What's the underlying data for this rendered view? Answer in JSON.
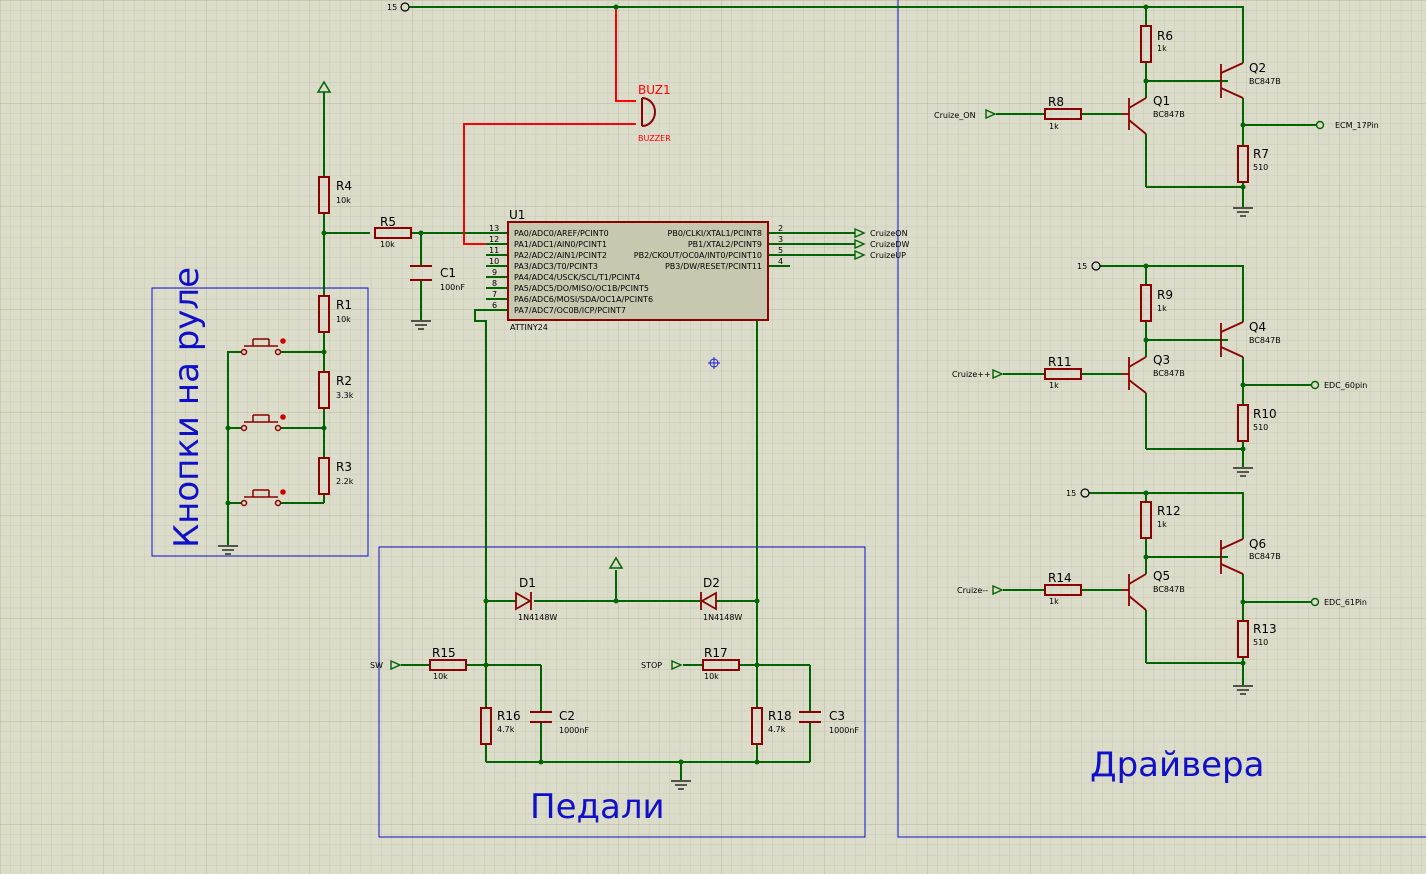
{
  "power_label": "15",
  "blocks": {
    "buttons": "Кнопки на руле",
    "pedals": "Педали",
    "drivers": "Драйвера"
  },
  "mcu": {
    "ref": "U1",
    "part": "ATTINY24",
    "left_pins": [
      {
        "num": "13",
        "name": "PA0/ADC0/AREF/PCINT0"
      },
      {
        "num": "12",
        "name": "PA1/ADC1/AIN0/PCINT1"
      },
      {
        "num": "11",
        "name": "PA2/ADC2/AIN1/PCINT2"
      },
      {
        "num": "10",
        "name": "PA3/ADC3/T0/PCINT3"
      },
      {
        "num": "9",
        "name": "PA4/ADC4/USCK/SCL/T1/PCINT4"
      },
      {
        "num": "8",
        "name": "PA5/ADC5/DO/MISO/OC1B/PCINT5"
      },
      {
        "num": "7",
        "name": "PA6/ADC6/MOSI/SDA/OC1A/PCINT6"
      },
      {
        "num": "6",
        "name": "PA7/ADC7/OC0B/ICP/PCINT7"
      }
    ],
    "right_pins": [
      {
        "num": "2",
        "name": "PB0/CLKI/XTAL1/PCINT8"
      },
      {
        "num": "3",
        "name": "PB1/XTAL2/PCINT9"
      },
      {
        "num": "5",
        "name": "PB2/CKOUT/OC0A/INT0/PCINT10"
      },
      {
        "num": "4",
        "name": "PB3/DW/RESET/PCINT11"
      }
    ]
  },
  "nets": {
    "cruize_on_out": "CruizeON",
    "cruize_dw_out": "CruizeDW",
    "cruize_up_out": "CruizeUP",
    "cruize_on_in": "Cruize_ON",
    "cruize_pp_in": "Cruize++",
    "cruize_mm_in": "Cruize--",
    "ecm": "ECM_17Pin",
    "edc60": "EDC_60pin",
    "edc61": "EDC_61Pin",
    "sw": "SW",
    "stop": "STOP"
  },
  "buzzer": {
    "ref": "BUZ1",
    "type": "BUZZER"
  },
  "resistors": {
    "R1": {
      "ref": "R1",
      "value": "10k"
    },
    "R2": {
      "ref": "R2",
      "value": "3.3k"
    },
    "R3": {
      "ref": "R3",
      "value": "2.2k"
    },
    "R4": {
      "ref": "R4",
      "value": "10k"
    },
    "R5": {
      "ref": "R5",
      "value": "10k"
    },
    "R6": {
      "ref": "R6",
      "value": "1k"
    },
    "R7": {
      "ref": "R7",
      "value": "510"
    },
    "R8": {
      "ref": "R8",
      "value": "1k"
    },
    "R9": {
      "ref": "R9",
      "value": "1k"
    },
    "R10": {
      "ref": "R10",
      "value": "510"
    },
    "R11": {
      "ref": "R11",
      "value": "1k"
    },
    "R12": {
      "ref": "R12",
      "value": "1k"
    },
    "R13": {
      "ref": "R13",
      "value": "510"
    },
    "R14": {
      "ref": "R14",
      "value": "1k"
    },
    "R15": {
      "ref": "R15",
      "value": "10k"
    },
    "R16": {
      "ref": "R16",
      "value": "4.7k"
    },
    "R17": {
      "ref": "R17",
      "value": "10k"
    },
    "R18": {
      "ref": "R18",
      "value": "4.7k"
    }
  },
  "capacitors": {
    "C1": {
      "ref": "C1",
      "value": "100nF"
    },
    "C2": {
      "ref": "C2",
      "value": "1000nF"
    },
    "C3": {
      "ref": "C3",
      "value": "1000nF"
    }
  },
  "diodes": {
    "D1": {
      "ref": "D1",
      "value": "1N4148W"
    },
    "D2": {
      "ref": "D2",
      "value": "1N4148W"
    }
  },
  "transistors": {
    "Q1": {
      "ref": "Q1",
      "value": "BC847B"
    },
    "Q2": {
      "ref": "Q2",
      "value": "BC847B"
    },
    "Q3": {
      "ref": "Q3",
      "value": "BC847B"
    },
    "Q4": {
      "ref": "Q4",
      "value": "BC847B"
    },
    "Q5": {
      "ref": "Q5",
      "value": "BC847B"
    },
    "Q6": {
      "ref": "Q6",
      "value": "BC847B"
    }
  },
  "colors": {
    "background": "#dcdccb",
    "grid_minor": "#c9c9b6",
    "grid_major": "#b6b6a2",
    "wire": "#006400",
    "part": "#8b0000",
    "chip_fill": "#c8c8b0",
    "buzzer_wire": "#ff0000",
    "block": "#1010c8"
  }
}
